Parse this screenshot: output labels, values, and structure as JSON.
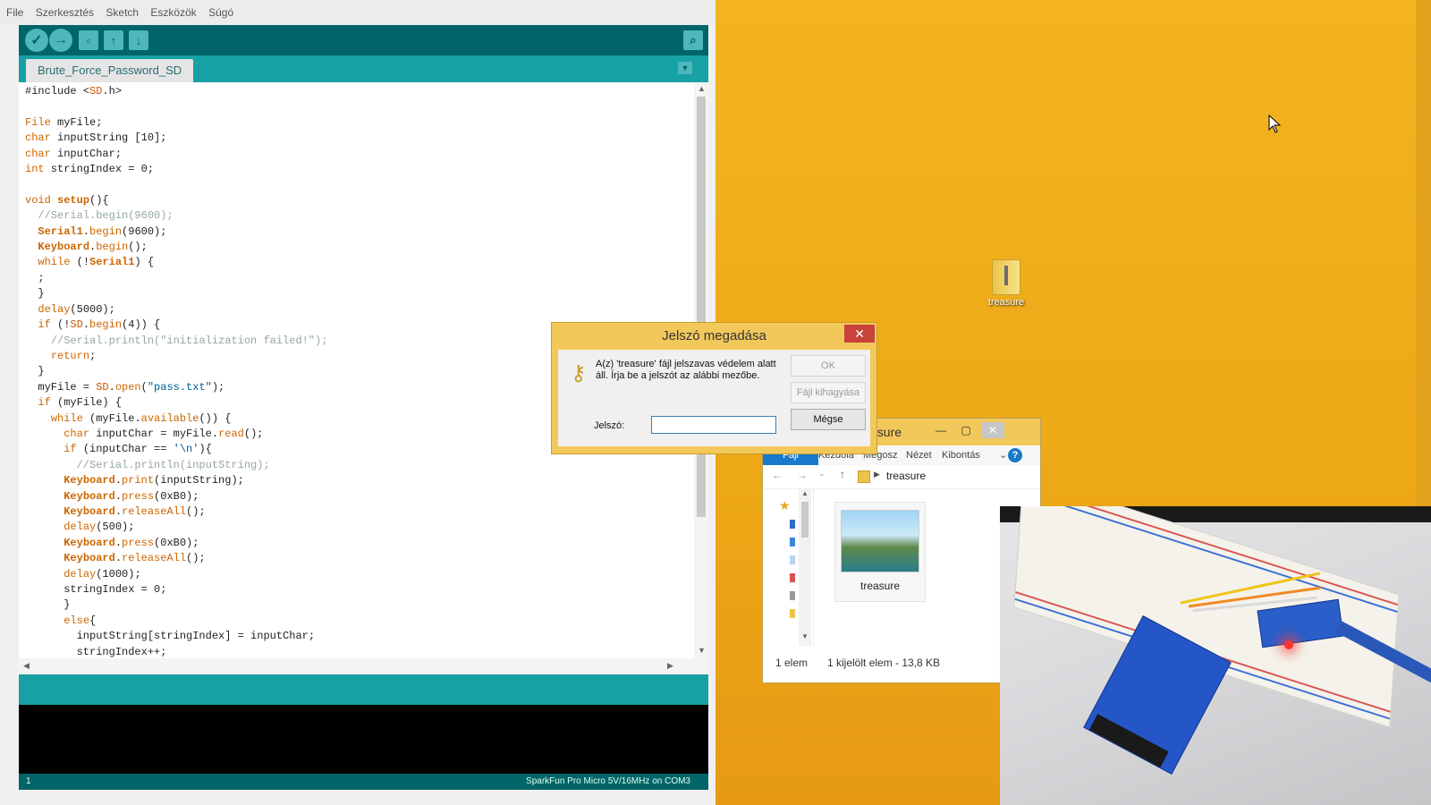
{
  "ide": {
    "menu": [
      "File",
      "Szerkesztés",
      "Sketch",
      "Eszközök",
      "Súgó"
    ],
    "toolbar": {
      "verify_icon": "checkmark-icon",
      "upload_icon": "arrow-right-icon",
      "new_icon": "new-file-icon",
      "open_icon": "open-arrow-up-icon",
      "save_icon": "save-arrow-down-icon",
      "serial_monitor_icon": "magnifier-icon"
    },
    "tab_name": "Brute_Force_Password_SD",
    "code_lines": [
      "#include <SD.h>",
      "",
      "File myFile;",
      "char inputString [10];",
      "char inputChar;",
      "int stringIndex = 0;",
      "",
      "void setup(){",
      "  //Serial.begin(9600);",
      "  Serial1.begin(9600);",
      "  Keyboard.begin();",
      "  while (!Serial1) {",
      "  ;",
      "  }",
      "  delay(5000);",
      "  if (!SD.begin(4)) {",
      "    //Serial.println(\"initialization failed!\");",
      "    return;",
      "  }",
      "  myFile = SD.open(\"pass.txt\");",
      "  if (myFile) {",
      "    while (myFile.available()) {",
      "      char inputChar = myFile.read();",
      "      if (inputChar == '\\n'){",
      "        //Serial.println(inputString);",
      "      Keyboard.print(inputString);",
      "      Keyboard.press(0xB0);",
      "      Keyboard.releaseAll();",
      "      delay(500);",
      "      Keyboard.press(0xB0);",
      "      Keyboard.releaseAll();",
      "      delay(1000);",
      "      stringIndex = 0;",
      "      }",
      "      else{",
      "        inputString[stringIndex] = inputChar;",
      "        stringIndex++;"
    ],
    "footer": {
      "line_number": "1",
      "board": "SparkFun Pro Micro 5V/16MHz on COM3"
    },
    "colors": {
      "teal_dark": "#006468",
      "teal": "#17a1a5",
      "keyword": "#cc6600"
    }
  },
  "desktop": {
    "folder_label": "treasure",
    "background_color": "#f3b420"
  },
  "explorer": {
    "title": "asure",
    "ribbon_tabs": [
      "Fájl",
      "Kezdőla",
      "Megosz",
      "Nézet",
      "Kibontás"
    ],
    "address_path": "treasure",
    "file_label": "treasure",
    "status_count": "1 elem",
    "status_selected": "1 kijelölt elem - 13,8 KB"
  },
  "dialog": {
    "title": "Jelszó megadása",
    "message": "A(z) 'treasure' fájl jelszavas védelem alatt áll. Írja be a jelszót az alábbi mezőbe.",
    "ok_label": "OK",
    "skip_label": "Fájl kihagyása",
    "cancel_label": "Mégse",
    "password_label": "Jelszó:",
    "password_value": "",
    "key_icon": "key-icon"
  }
}
